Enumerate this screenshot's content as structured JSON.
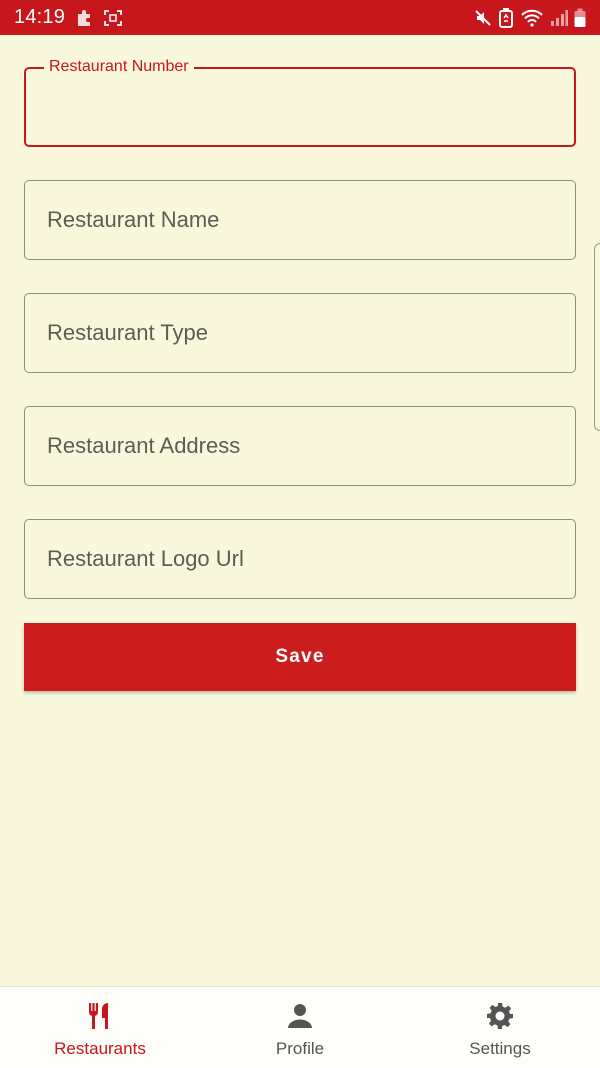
{
  "status_bar": {
    "time": "14:19",
    "left_icons": [
      "puzzle-icon",
      "screenshot-icon"
    ],
    "right_icons": [
      "mute-icon",
      "battery-saver-icon",
      "wifi-icon",
      "signal-icon",
      "battery-icon"
    ]
  },
  "form": {
    "restaurant_number": {
      "label": "Restaurant Number",
      "value": ""
    },
    "restaurant_name": {
      "placeholder": "Restaurant Name",
      "value": ""
    },
    "restaurant_type": {
      "placeholder": "Restaurant Type",
      "value": ""
    },
    "restaurant_address": {
      "placeholder": "Restaurant Address",
      "value": ""
    },
    "restaurant_logo_url": {
      "placeholder": "Restaurant Logo Url",
      "value": ""
    },
    "save_label": "Save"
  },
  "bottom_nav": {
    "items": [
      {
        "label": "Restaurants",
        "icon": "restaurant-icon",
        "active": true
      },
      {
        "label": "Profile",
        "icon": "person-icon",
        "active": false
      },
      {
        "label": "Settings",
        "icon": "gear-icon",
        "active": false
      }
    ]
  },
  "colors": {
    "accent": "#c8171c",
    "background": "#f9f7dc",
    "nav_background": "#fdfdf9",
    "inactive": "#555555"
  }
}
